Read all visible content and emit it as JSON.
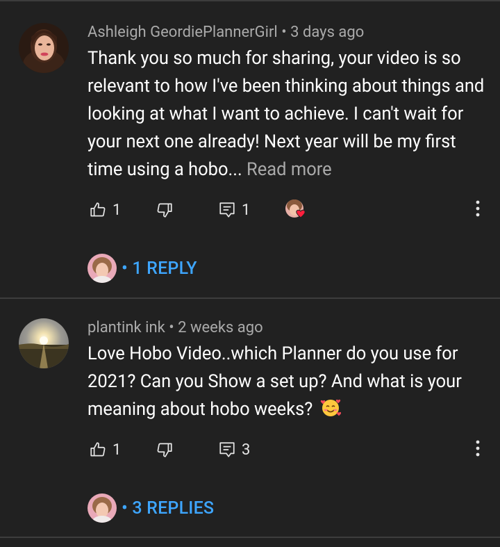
{
  "comments": [
    {
      "author": "Ashleigh GeordiePlannerGirl",
      "separator": "•",
      "time": "3 days ago",
      "text": "Thank you so much for sharing, your video is so relevant to how I've been thinking about things and looking at what I want to achieve. I can't wait for your next one already! Next year will be my first time using a hobo... ",
      "read_more": "Read more",
      "likes": "1",
      "replies_count": "1",
      "creator_hearted": true,
      "reply_link": "• 1 REPLY"
    },
    {
      "author": "plantink ink",
      "separator": "•",
      "time": "2 weeks ago",
      "text": "Love Hobo Video..which Planner do you use for 2021? Can you Show  a set up? And what is your meaning about hobo weeks? ",
      "emoji": "smiling-face-with-hearts",
      "likes": "1",
      "replies_count": "3",
      "creator_hearted": false,
      "reply_link": "• 3 REPLIES"
    }
  ],
  "colors": {
    "background": "#212121",
    "link_blue": "#3ea6ff",
    "meta_gray": "#aaaaaa",
    "heart_red": "#ff1f3d"
  }
}
